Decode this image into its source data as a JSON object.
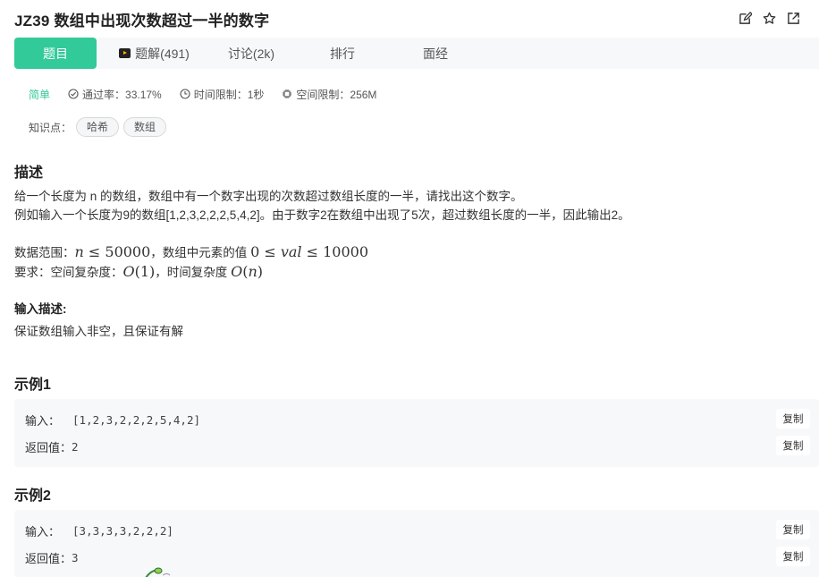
{
  "title": "JZ39  数组中出现次数超过一半的数字",
  "title_icons": [
    "edit-icon",
    "star-icon",
    "open-external-icon"
  ],
  "tabs": [
    {
      "label": "题目",
      "active": true
    },
    {
      "label": "题解(491)",
      "icon": "video-icon"
    },
    {
      "label": "讨论(2k)"
    },
    {
      "label": "排行"
    },
    {
      "label": "面经"
    }
  ],
  "meta": {
    "level": "简单",
    "pass_rate": "通过率：33.17%",
    "time_limit": "时间限制：1秒",
    "space_limit": "空间限制：256M"
  },
  "knowledge": {
    "label": "知识点：",
    "tags": [
      "哈希",
      "数组"
    ]
  },
  "description": {
    "heading": "描述",
    "line1": "给一个长度为 n 的数组，数组中有一个数字出现的次数超过数组长度的一半，请找出这个数字。",
    "line2": "例如输入一个长度为9的数组[1,2,3,2,2,2,5,4,2]。由于数字2在数组中出现了5次，超过数组长度的一半，因此输出2。",
    "range_prefix": "数据范围：",
    "range_math1": "n ≤ 50000",
    "range_mid": "，数组中元素的值 ",
    "range_math2": "0 ≤ val ≤ 10000",
    "req_prefix": "要求：空间复杂度：",
    "req_math1": "O(1)",
    "req_mid": "，时间复杂度 ",
    "req_math2": "O(n)"
  },
  "input_desc": {
    "heading": "输入描述:",
    "text": "保证数组输入非空，且保证有解"
  },
  "examples": [
    {
      "heading": "示例1",
      "input_label": "输入：",
      "input_value": "[1,2,3,2,2,2,5,4,2]",
      "output_label": "返回值：",
      "output_value": "2",
      "copy_label": "复制"
    },
    {
      "heading": "示例2",
      "input_label": "输入：",
      "input_value": "[3,3,3,3,2,2,2]",
      "output_label": "返回值：",
      "output_value": "3",
      "copy_label": "复制"
    }
  ],
  "colors": {
    "accent": "#32ca99",
    "tab_bg": "#f7f8fa",
    "example_bg": "#f7f8fa"
  }
}
